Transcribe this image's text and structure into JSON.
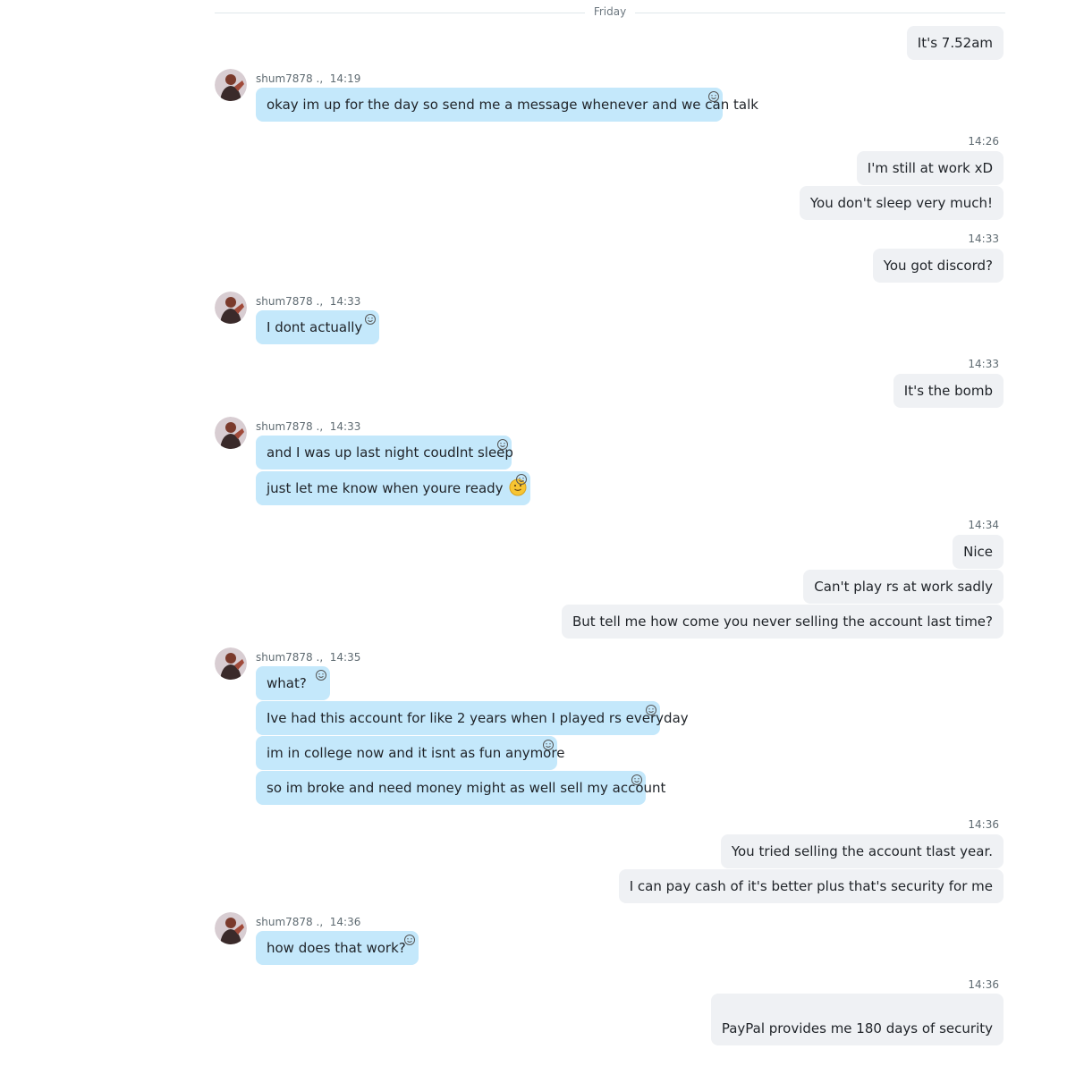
{
  "day_divider": "Friday",
  "contact": {
    "display": "shum7878 ."
  },
  "messages": [
    {
      "text": "It's 7.52am"
    },
    {
      "text": "okay im up for the day so send me a message whenever and we can talk"
    },
    {
      "text": "I'm still at work xD"
    },
    {
      "text": "You don't sleep very much!"
    },
    {
      "text": "You got discord?"
    },
    {
      "text": "I dont actually"
    },
    {
      "text": "It's the bomb"
    },
    {
      "text": "and I was up last night coudlnt sleep"
    },
    {
      "text": "just let me know when youre ready"
    },
    {
      "text": "Nice"
    },
    {
      "text": "Can't play rs at work sadly"
    },
    {
      "text": "But tell me how come you never selling the account last time?"
    },
    {
      "text": "what?"
    },
    {
      "text": "Ive had this account for like 2 years when I played rs everyday"
    },
    {
      "text": "im in college now and it isnt as fun anymore"
    },
    {
      "text": "so im broke and need money might as well sell my account"
    },
    {
      "text": "You tried selling the account tlast year."
    },
    {
      "text": "I can pay cash of it's better plus that's security for me"
    },
    {
      "text": "how does that work?"
    },
    {
      "text": "PayPal provides me 180 days of security"
    }
  ],
  "timestamps": {
    "t1419": "14:19",
    "t1426": "14:26",
    "t1433": "14:33",
    "t1434": "14:34",
    "t1435": "14:35",
    "t1436": "14:36"
  },
  "colors": {
    "incoming_bubble": "#c4e8fb",
    "outgoing_bubble": "#eff1f4",
    "text": "#1f2328",
    "meta": "#5f6b72"
  },
  "icons": {
    "reaction": "smiley-outline-icon",
    "emoji": "slight-smile-emoji-icon",
    "avatar": "contact-avatar"
  }
}
